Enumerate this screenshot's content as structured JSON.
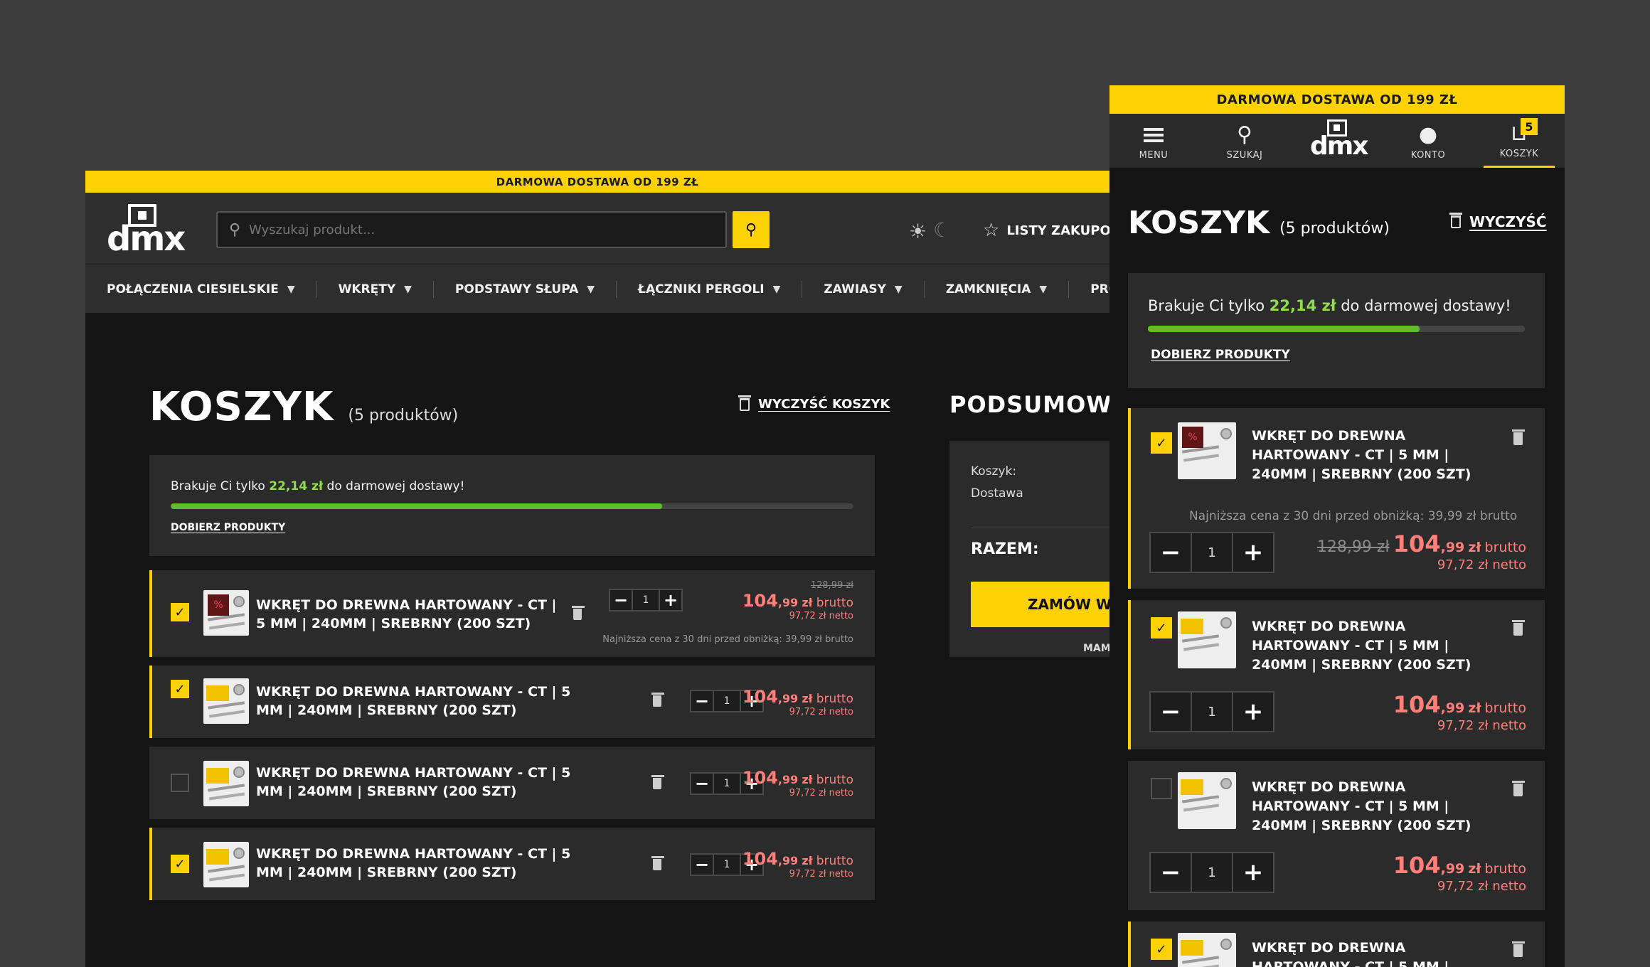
{
  "promo": "DARMOWA DOSTAWA OD 199 ZŁ",
  "logo_text": "dmx",
  "search": {
    "placeholder": "Wyszukaj produkt..."
  },
  "header": {
    "lists_label": "LISTY ZAKUPOW"
  },
  "nav": [
    "POŁĄCZENIA CIESIELSKIE",
    "WKRĘTY",
    "PODSTAWY SŁUPA",
    "ŁĄCZNIKI PERGOLI",
    "ZAWIASY",
    "ZAMKNIĘCIA",
    "PRO"
  ],
  "cart": {
    "title": "KOSZYK",
    "count": "(5 produktów)",
    "clear_label": "WYCZYŚĆ KOSZYK",
    "clear_label_mobile": "WYCZYŚĆ",
    "free_before": "Brakuje Ci tylko ",
    "free_amount": "22,14 zł",
    "free_after": " do darmowej dostawy!",
    "free_progress": 0.72,
    "more_label": "DOBIERZ PRODUKTY",
    "product_name": "WKRĘT DO DREWNA HARTOWANY - CT | 5 MM | 240MM | SREBRNY (200 SZT)",
    "lowest_price_note": "Najniższa cena z 30 dni przed obniżką: 39,99 zł brutto",
    "items": [
      {
        "checked": true,
        "qty": "1",
        "old_price": "128,99 zł",
        "price_int": "104",
        "price_dec": ",99",
        "currency": "zł",
        "gross": "brutto",
        "net": "97,72 zł netto",
        "promo_badge": "%"
      },
      {
        "checked": true,
        "qty": "1",
        "price_int": "104",
        "price_dec": ",99",
        "currency": "zł",
        "gross": "brutto",
        "net": "97,72 zł netto"
      },
      {
        "checked": false,
        "qty": "1",
        "price_int": "104",
        "price_dec": ",99",
        "currency": "zł",
        "gross": "brutto",
        "net": "97,72 zł netto"
      },
      {
        "checked": true,
        "qty": "1",
        "price_int": "104",
        "price_dec": ",99",
        "currency": "zł",
        "gross": "brutto",
        "net": "97,72 zł netto"
      }
    ]
  },
  "summary": {
    "title": "PODSUMOWAI",
    "cart_label": "Koszyk:",
    "shipping_label": "Dostawa",
    "total_label": "RAZEM:",
    "order_button": "ZAMÓW WY",
    "have_code": "MAM"
  },
  "mobile_nav": [
    {
      "label": "MENU",
      "icon": "menu-icon"
    },
    {
      "label": "SZUKAJ",
      "icon": "search-icon"
    },
    {
      "label": "KONTO",
      "icon": "user-icon"
    },
    {
      "label": "KOSZYK",
      "icon": "cart-icon",
      "badge": "5"
    }
  ],
  "icons": {
    "search": "⚲",
    "sun": "☀",
    "moon": "☾",
    "star": "☆",
    "chevron": "⌄",
    "check": "✓",
    "user": "👤",
    "cart": "🛒"
  },
  "colors": {
    "accent": "#fdd205",
    "price": "#ff7f7a",
    "progress": "#5fbe2e",
    "free_amount": "#8fdc4e"
  }
}
